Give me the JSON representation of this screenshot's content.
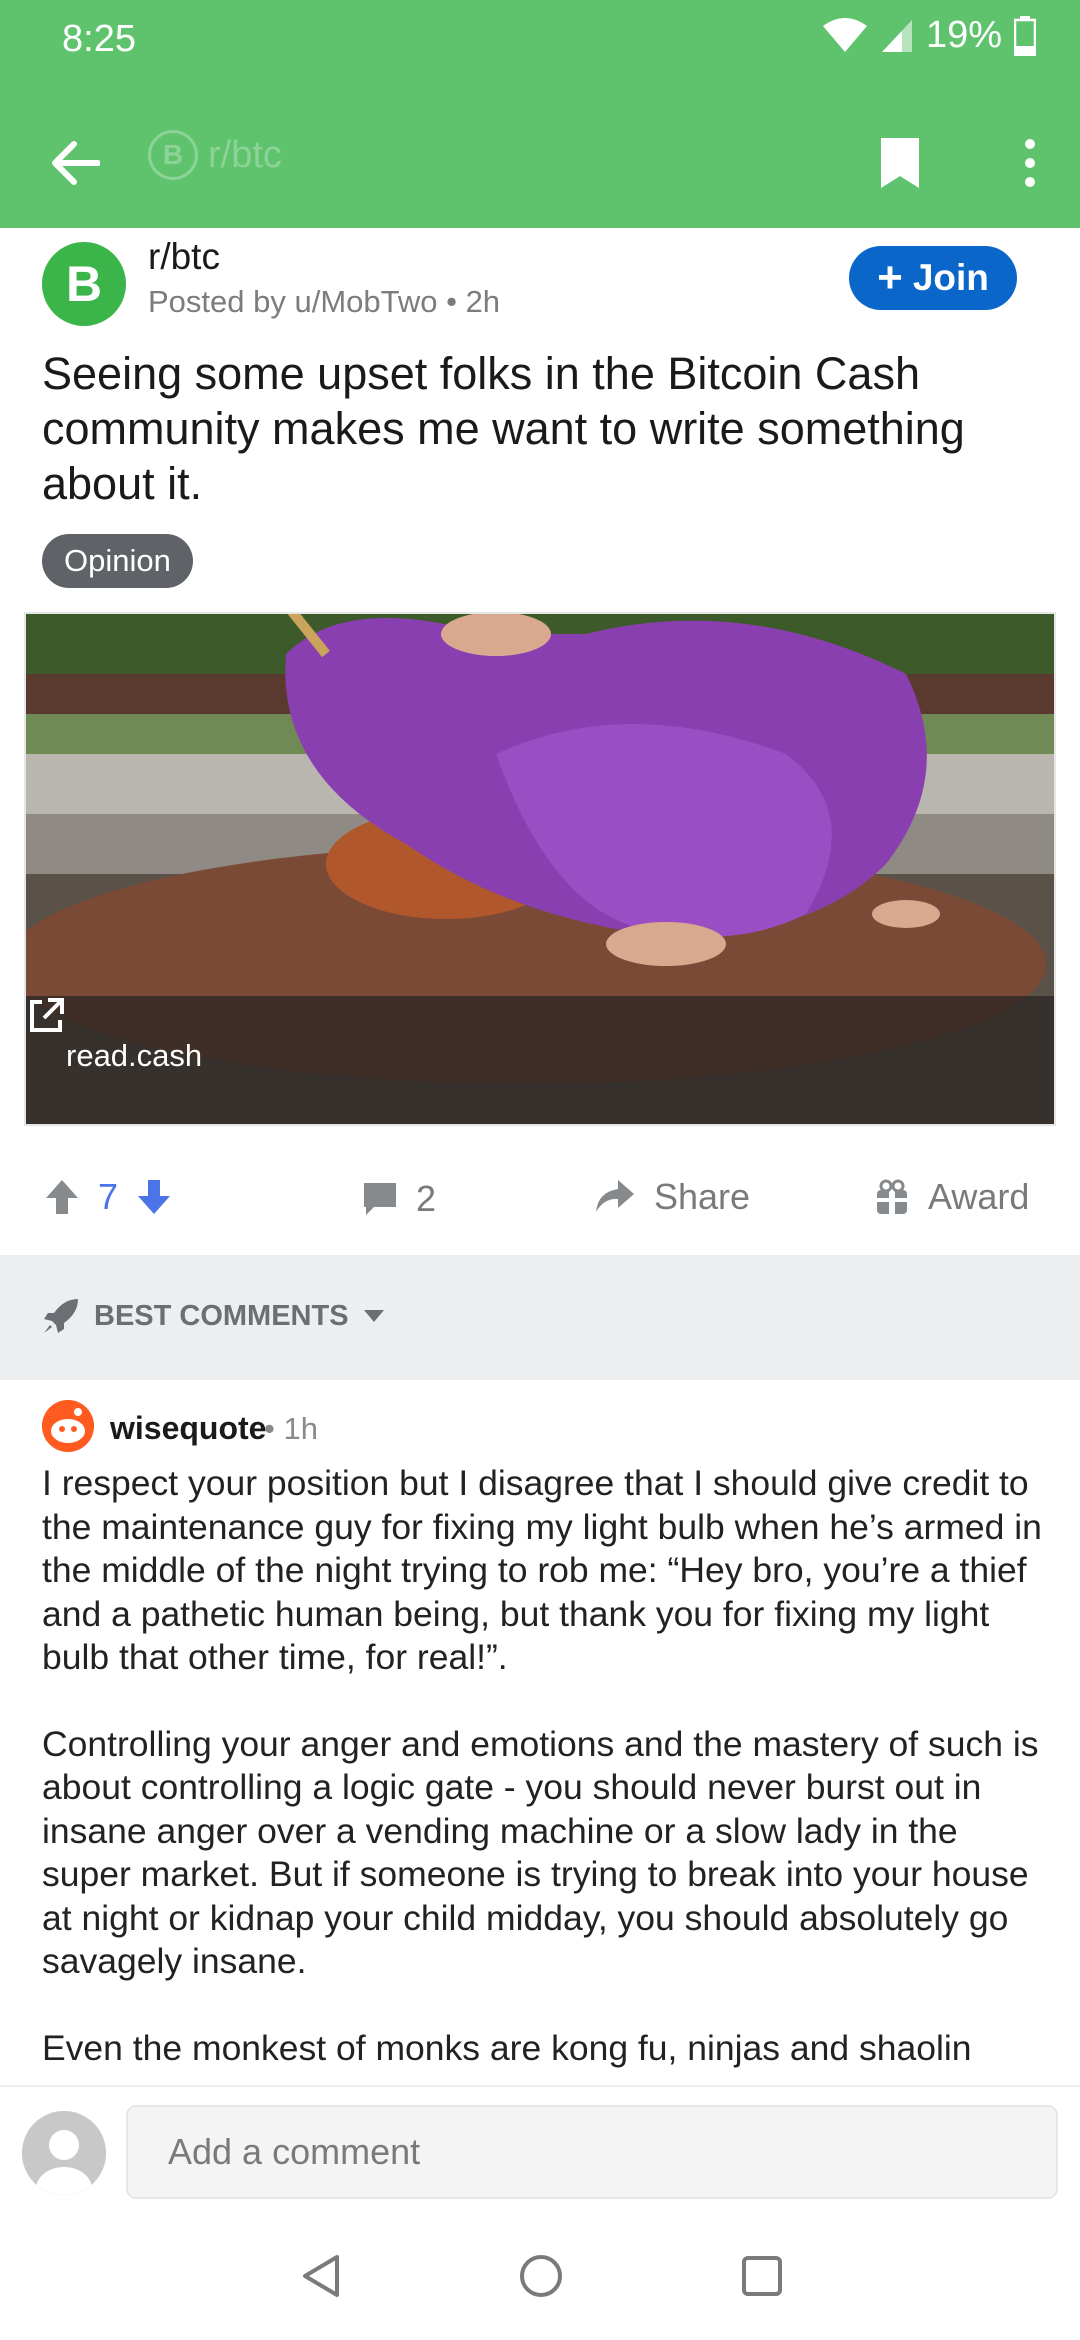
{
  "status_bar": {
    "time": "8:25",
    "battery": "19%"
  },
  "app_bar": {
    "title_faded": "r/btc",
    "title_icon": "B"
  },
  "post": {
    "subreddit": "r/btc",
    "avatar_letter": "B",
    "posted_by": "Posted by u/MobTwo • 2h",
    "join_label": "Join",
    "title": "Seeing some upset folks in the Bitcoin Cash community makes me want to write something about it.",
    "flair": "Opinion",
    "link_domain": "read.cash",
    "score": "7",
    "comment_count": "2",
    "share_label": "Share",
    "award_label": "Award"
  },
  "sort": {
    "label": "BEST COMMENTS"
  },
  "comment": {
    "author": "wisequote",
    "time": "• 1h",
    "paragraphs": [
      "I respect your position but I disagree that I should give credit to the maintenance guy for fixing my light bulb when he’s armed in the middle of the night trying to rob me: “Hey bro, you’re a thief and a pathetic human being, but thank you for fixing my light bulb that other time, for real!”.",
      "Controlling your anger and emotions and the mastery of such is about controlling a logic gate - you should never burst out in insane anger over a vending machine or a slow lady in the super market. But if someone is trying to break into your house at night or kidnap your child midday, you should absolutely go savagely insane.",
      "Even the monkest of monks are kong fu, ninjas and shaolin"
    ]
  },
  "compose": {
    "placeholder": "Add a comment"
  },
  "colors": {
    "header": "#5fc36e",
    "join": "#0a66c8",
    "upvote": "#4a74e8"
  }
}
